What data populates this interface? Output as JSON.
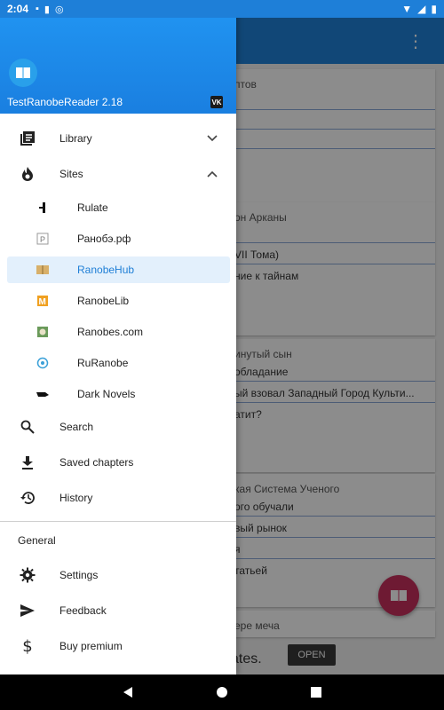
{
  "status_bar": {
    "time": "2:04"
  },
  "drawer": {
    "app_name": "TestRanobeReader 2.18",
    "vk_label": "VK",
    "items": [
      {
        "label": "Library",
        "icon": "library-icon"
      },
      {
        "label": "Sites",
        "icon": "fire-icon"
      }
    ],
    "sites": [
      {
        "label": "Rulate",
        "icon": "rulate-icon"
      },
      {
        "label": "Ранобэ.рф",
        "icon": "ranobe-rf-icon"
      },
      {
        "label": "RanobeHub",
        "icon": "ranobehub-icon"
      },
      {
        "label": "RanobeLib",
        "icon": "ranobelib-icon"
      },
      {
        "label": "Ranobes.com",
        "icon": "ranobes-icon"
      },
      {
        "label": "RuRanobe",
        "icon": "ruranobe-icon"
      },
      {
        "label": "Dark Novels",
        "icon": "dark-novels-icon"
      }
    ],
    "more_items": [
      {
        "label": "Search",
        "icon": "search-icon"
      },
      {
        "label": "Saved chapters",
        "icon": "download-icon"
      },
      {
        "label": "History",
        "icon": "history-icon"
      }
    ],
    "section_label": "General",
    "general_items": [
      {
        "label": "Settings",
        "icon": "gear-icon"
      },
      {
        "label": "Feedback",
        "icon": "send-icon"
      },
      {
        "label": "Buy premium",
        "icon": "dollar-icon"
      }
    ]
  },
  "background": {
    "card1": {
      "title": "птов"
    },
    "card2": {
      "title": "он Арканы",
      "lines": [
        "VII Тома)",
        "ние к тайнам"
      ]
    },
    "card3": {
      "title": "инутый сын",
      "lines": [
        "обладание",
        "ый взовал Западный Город Культи...",
        "атит?"
      ]
    },
    "card4": {
      "title": "кая Система Ученого",
      "lines": [
        "ого обучали",
        "вый рынок",
        "я",
        "татьей"
      ]
    },
    "card5": {
      "title": "ере меча"
    },
    "ad_text": "ates.",
    "ad_button": "OPEN"
  },
  "colors": {
    "accent": "#1f82d9",
    "fab": "#c9305e",
    "active_bg": "#e3f0fc",
    "active_text": "#1f7fd6"
  }
}
